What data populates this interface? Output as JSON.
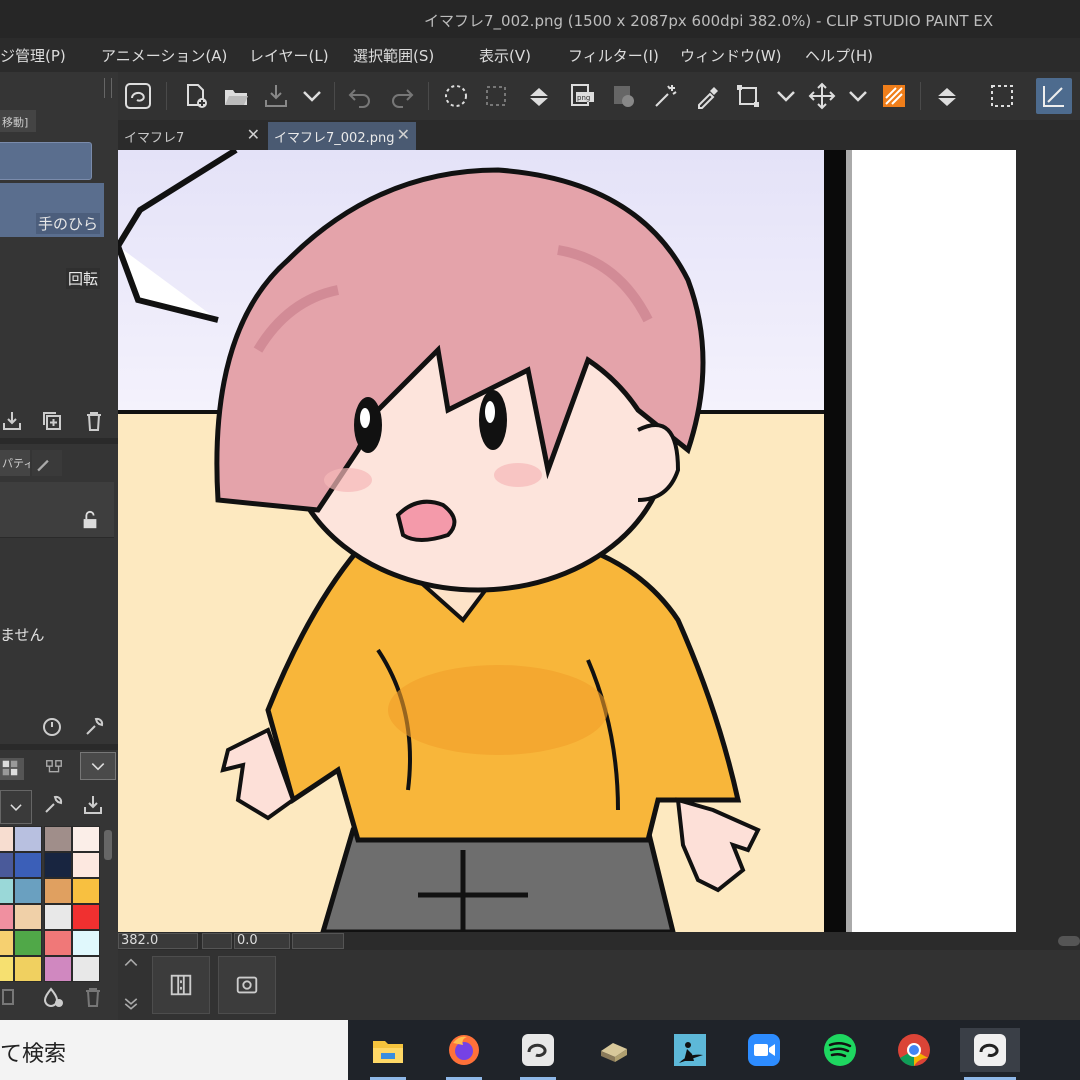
{
  "window": {
    "title": "イマフレ7_002.png (1500 x 2087px 600dpi 382.0%)  - CLIP STUDIO PAINT EX"
  },
  "menu": [
    "ジ管理(P)",
    "アニメーション(A)",
    "レイヤー(L)",
    "選択範囲(S)",
    "表示(V)",
    "フィルター(I)",
    "ウィンドウ(W)",
    "ヘルプ(H)"
  ],
  "left_panel": {
    "tab_label": "移動]",
    "subtools": [
      {
        "label": "手のひら",
        "selected": true
      },
      {
        "label": "回転",
        "selected": false
      }
    ],
    "property_tab": "パティ",
    "no_selection_text": "ません"
  },
  "doc_tabs": [
    {
      "label": "イマフレ7",
      "active": false
    },
    {
      "label": "イマフレ7_002.png",
      "active": true
    }
  ],
  "status": {
    "zoom": "382.0",
    "rotation": "0.0"
  },
  "taskbar": {
    "search_text": "て検索",
    "apps": [
      {
        "icon": "file-explorer-icon",
        "running": true
      },
      {
        "icon": "firefox-icon",
        "running": true
      },
      {
        "icon": "clip-studio-icon",
        "running": true
      },
      {
        "icon": "app-drive-icon",
        "running": false
      },
      {
        "icon": "kindle-icon",
        "running": false
      },
      {
        "icon": "zoom-icon",
        "running": false
      },
      {
        "icon": "spotify-icon",
        "running": false
      },
      {
        "icon": "chrome-icon",
        "running": false
      },
      {
        "icon": "clip-studio-paint-icon",
        "running": true
      }
    ]
  },
  "palette_colors": [
    "#f7ddd0",
    "#b8c0e0",
    "#a08e8a",
    "#fbeee8",
    "#4a5a9a",
    "#3b5fb8",
    "#182540",
    "#fde8e0",
    "#9ad8d8",
    "#6aa0c0",
    "#e0a060",
    "#f8c040",
    "#f090a0",
    "#f0d0a8",
    "#e8e8e8",
    "#f03030",
    "#f6d070",
    "#50a848",
    "#f07878",
    "#e0f8fc",
    "#f6e070",
    "#f0d060",
    "#d088c0",
    "#e8e8e8"
  ],
  "colors": {
    "accent": "#4d6b8e",
    "selected_item": "#5a6e8e"
  }
}
